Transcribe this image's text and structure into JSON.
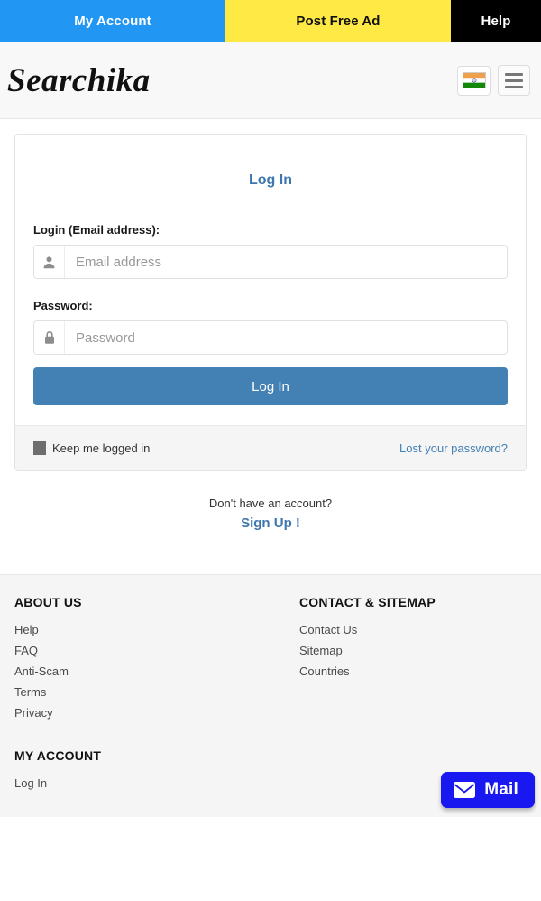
{
  "topnav": {
    "items": [
      {
        "label": "My Account",
        "color": "#2196f3"
      },
      {
        "label": "Post Free Ad",
        "color": "#ffe945"
      },
      {
        "label": "Help",
        "color": "#000000"
      }
    ]
  },
  "header": {
    "logo": "Searchika",
    "flag_icon": "india-flag-icon",
    "menu_icon": "hamburger-menu-icon"
  },
  "login_card": {
    "title": "Log In",
    "email": {
      "label": "Login (Email address):",
      "placeholder": "Email address",
      "value": "",
      "icon": "user-icon"
    },
    "password": {
      "label": "Password:",
      "placeholder": "Password",
      "value": "",
      "icon": "lock-icon"
    },
    "submit_label": "Log In",
    "keep_logged_in_label": "Keep me logged in",
    "keep_logged_in_checked": true,
    "lost_password_label": "Lost your password?",
    "accent_color": "#4380b4",
    "title_color": "#3d77ad"
  },
  "signup": {
    "question": "Don't have an account?",
    "link_label": "Sign Up !"
  },
  "footer": {
    "about": {
      "heading": "ABOUT US",
      "links": [
        "Help",
        "FAQ",
        "Anti-Scam",
        "Terms",
        "Privacy"
      ]
    },
    "my_account": {
      "heading": "MY ACCOUNT",
      "links": [
        "Log In"
      ]
    },
    "contact": {
      "heading": "CONTACT & SITEMAP",
      "links": [
        "Contact Us",
        "Sitemap",
        "Countries"
      ]
    }
  },
  "mail_widget": {
    "label": "Mail",
    "icon": "envelope-icon",
    "color": "#1a18f0"
  }
}
